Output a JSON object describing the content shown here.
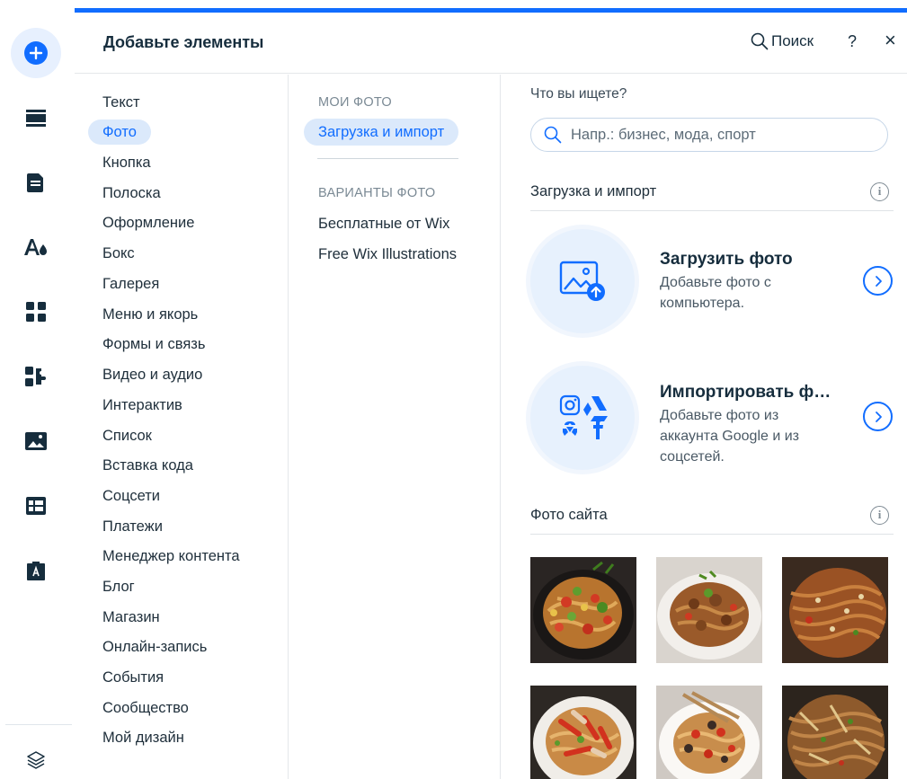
{
  "panel": {
    "title": "Добавьте элементы",
    "search_label": "Поиск",
    "help_label": "?",
    "close_label": "×"
  },
  "rail": {
    "items": [
      "add-icon",
      "sections-icon",
      "pages-icon",
      "theme-icon",
      "apps-icon",
      "business-apps-icon",
      "media-icon",
      "cms-table-icon",
      "portfolio-icon",
      "layers-icon"
    ],
    "accent": "#116dff"
  },
  "categories": [
    "Текст",
    "Фото",
    "Кнопка",
    "Полоска",
    "Оформление",
    "Бокс",
    "Галерея",
    "Меню и якорь",
    "Формы и связь",
    "Видео и аудио",
    "Интерактив",
    "Список",
    "Вставка кода",
    "Соцсети",
    "Платежи",
    "Менеджер контента",
    "Блог",
    "Магазин",
    "Онлайн-запись",
    "События",
    "Сообщество",
    "Мой дизайн"
  ],
  "selected_category": "Фото",
  "subcategories": {
    "my_photos_heading": "МОИ ФОТО",
    "upload_import": "Загрузка и импорт",
    "photo_options_heading": "ВАРИАНТЫ ФОТО",
    "free_from_wix": "Бесплатные от Wix",
    "free_illustrations": "Free Wix Illustrations"
  },
  "content": {
    "search_label": "Что вы ищете?",
    "search_placeholder": "Напр.: бизнес, мода, спорт",
    "section_upload": "Загрузка и импорт",
    "upload_card": {
      "title": "Загрузить фото",
      "desc": "Добавьте фото с компьютера."
    },
    "import_card": {
      "title": "Импортировать ф…",
      "desc": "Добавьте фото из аккаунта Google и из соцсетей."
    },
    "section_site_photos": "Фото сайта",
    "site_photos": [
      "noodle-photo-1",
      "noodle-photo-2",
      "noodle-photo-3",
      "noodle-photo-4",
      "noodle-photo-5",
      "noodle-photo-6"
    ],
    "info_label": "i"
  }
}
